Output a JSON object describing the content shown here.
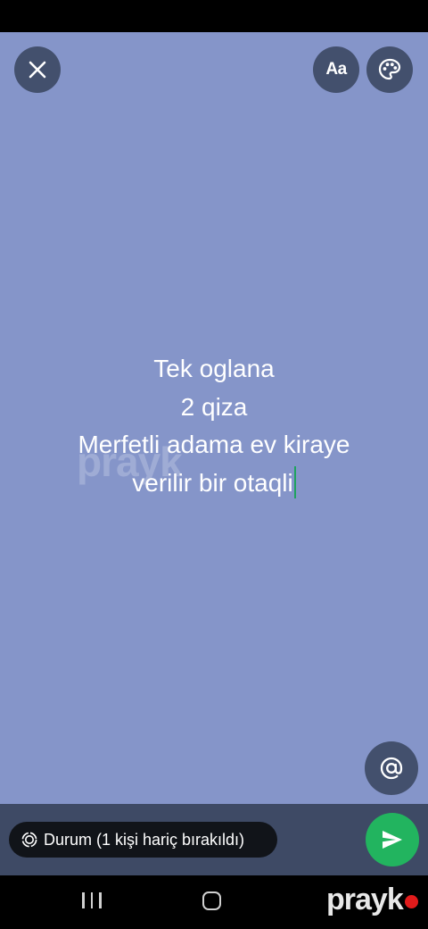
{
  "status_text": {
    "lines": [
      "Tek oglana",
      "2 qiza",
      "Merfetli adama ev kiraye",
      "verilir bir otaqli"
    ]
  },
  "toolbar": {
    "font_label": "Aa"
  },
  "audience": {
    "label": "Durum (1 kişi hariç bırakıldı)"
  },
  "watermark": {
    "text": "prayk"
  },
  "colors": {
    "background": "#8595c9",
    "button_bg": "#3e4a65",
    "send": "#22b45f",
    "caret": "#1fa35e",
    "brand_dot": "#e21b1b"
  },
  "icons": [
    "close-icon",
    "palette-icon",
    "at-icon",
    "status-icon",
    "send-icon",
    "nav-recents-icon",
    "nav-home-icon"
  ]
}
